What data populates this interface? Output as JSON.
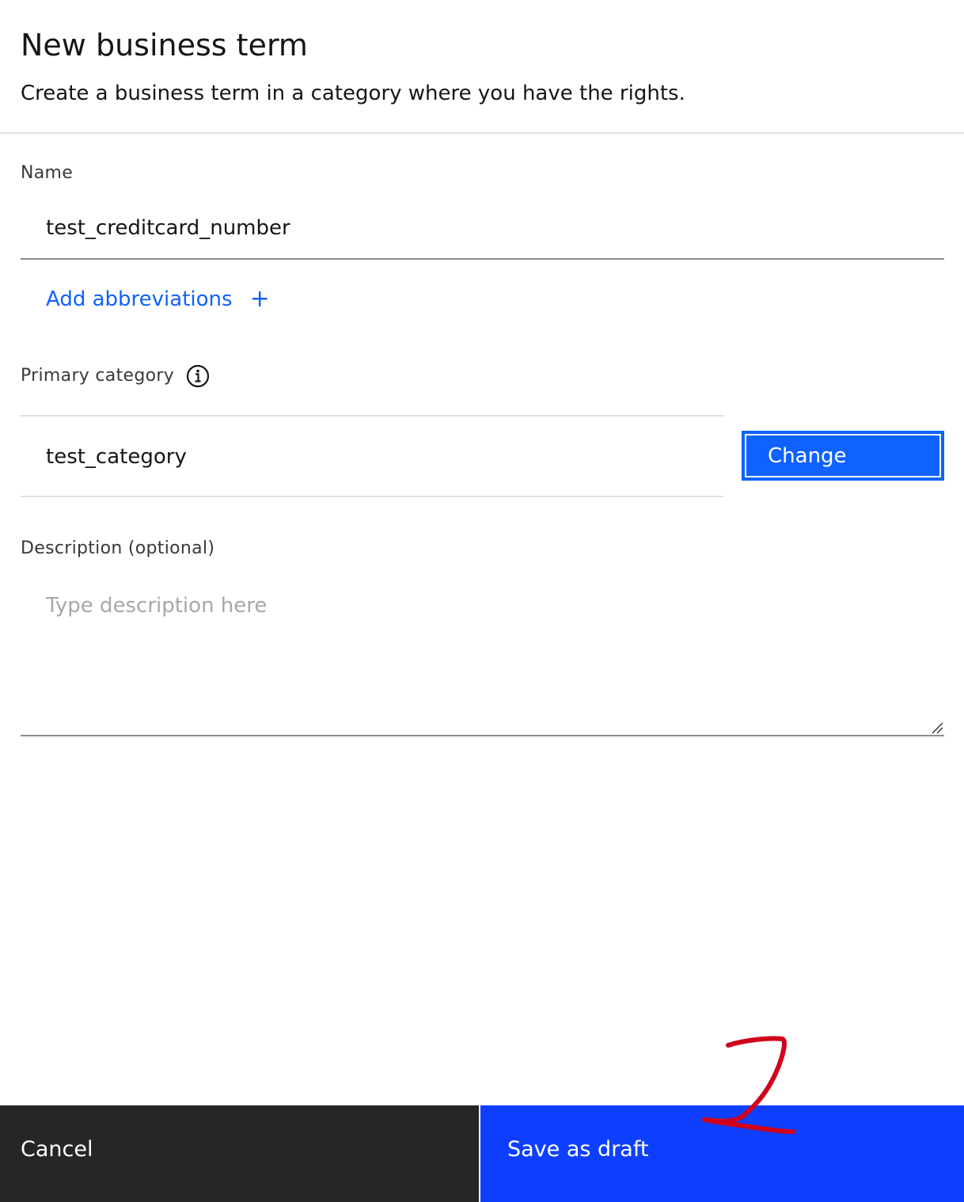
{
  "header": {
    "title": "New business term",
    "subtitle": "Create a business term in a category where you have the rights."
  },
  "name": {
    "label": "Name",
    "value": "test_creditcard_number"
  },
  "abbreviations": {
    "link_label": "Add abbreviations",
    "plus_glyph": "+"
  },
  "primary_category": {
    "label": "Primary category",
    "value": "test_category",
    "change_label": "Change",
    "info_icon": "info-icon"
  },
  "description": {
    "label": "Description (optional)",
    "placeholder": "Type description here",
    "value": ""
  },
  "footer": {
    "cancel_label": "Cancel",
    "save_label": "Save as draft"
  },
  "colors": {
    "primary": "#0f62fe",
    "save_bg": "#0f3ffe",
    "cancel_bg": "#262626",
    "annotation": "#d0021b"
  }
}
